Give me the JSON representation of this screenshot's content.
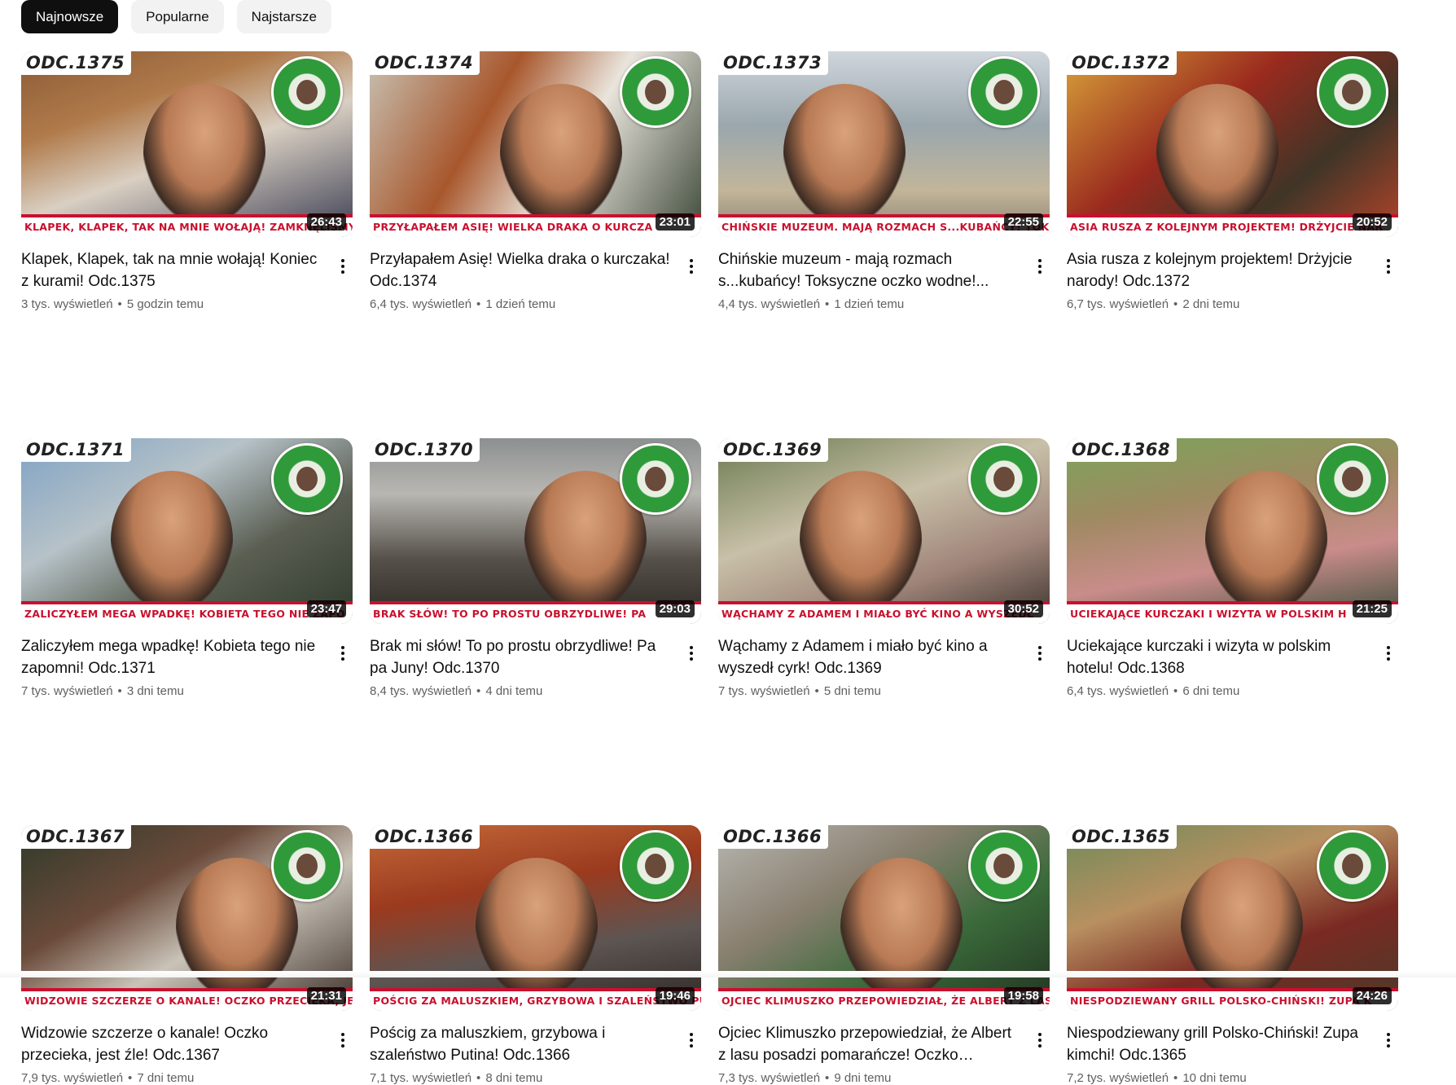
{
  "filters": [
    "Najnowsze",
    "Popularne",
    "Najstarsze"
  ],
  "active_filter": "Najnowsze",
  "videos": [
    {
      "ep": "ODC.1375",
      "banner": "Klapek, klapek, tak na mnie wołają! Zamknęliśmy tema",
      "duration": "26:43",
      "title": "Klapek, Klapek, tak na mnie wołają! Koniec z kurami! Odc.1375",
      "views": "3 tys. wyświetleń",
      "age": "5 godzin temu"
    },
    {
      "ep": "ODC.1374",
      "banner": "Przyłapałem Asię! Wielka draka o kurcza",
      "duration": "23:01",
      "title": "Przyłapałem Asię! Wielka draka o kurczaka! Odc.1374",
      "views": "6,4 tys. wyświetleń",
      "age": "1 dzień temu"
    },
    {
      "ep": "ODC.1373",
      "banner": "Chińskie muzeum. Mają rozmach s...kubańcy! Toksyczne",
      "duration": "22:55",
      "title": "Chińskie muzeum - mają rozmach s...kubańcy! Toksyczne oczko wodne!...",
      "views": "4,4 tys. wyświetleń",
      "age": "1 dzień temu"
    },
    {
      "ep": "ODC.1372",
      "banner": "Asia rusza z kolejnym projektem! Drżyjcie nar",
      "duration": "20:52",
      "title": "Asia rusza z kolejnym projektem! Drżyjcie narody! Odc.1372",
      "views": "6,7 tys. wyświetleń",
      "age": "2 dni temu"
    },
    {
      "ep": "ODC.1371",
      "banner": "Zaliczyłem mega wpadkę! Kobieta tego nie zapo",
      "duration": "23:47",
      "title": "Zaliczyłem mega wpadkę! Kobieta tego nie zapomni! Odc.1371",
      "views": "7 tys. wyświetleń",
      "age": "3 dni temu"
    },
    {
      "ep": "ODC.1370",
      "banner": "Brak słów! To po prostu obrzydliwe! Pa",
      "duration": "29:03",
      "title": "Brak mi słów! To po prostu obrzydliwe! Pa pa Juny! Odc.1370",
      "views": "8,4 tys. wyświetleń",
      "age": "4 dni temu"
    },
    {
      "ep": "ODC.1369",
      "banner": "Wąchamy z Adamem i miało być kino a wyszedł",
      "duration": "30:52",
      "title": "Wąchamy z Adamem i miało być kino a wyszedł cyrk! Odc.1369",
      "views": "7 tys. wyświetleń",
      "age": "5 dni temu"
    },
    {
      "ep": "ODC.1368",
      "banner": "Uciekające kurczaki i wizyta w polskim h",
      "duration": "21:25",
      "title": "Uciekające kurczaki i wizyta w polskim hotelu! Odc.1368",
      "views": "6,4 tys. wyświetleń",
      "age": "6 dni temu"
    },
    {
      "ep": "ODC.1367",
      "banner": "Widzowie szczerze o kanale! Oczko przecieka, je",
      "duration": "21:31",
      "title": "Widzowie szczerze o kanale! Oczko przecieka, jest źle! Odc.1367",
      "views": "7,9 tys. wyświetleń",
      "age": "7 dni temu"
    },
    {
      "ep": "ODC.1366",
      "banner": "Pościg za maluszkiem, grzybowa i szaleństwo pu",
      "duration": "19:46",
      "title": "Pościg za maluszkiem, grzybowa i szaleństwo Putina! Odc.1366",
      "views": "7,1 tys. wyświetleń",
      "age": "8 dni temu"
    },
    {
      "ep": "ODC.1366",
      "banner": "Ojciec Klimuszko przepowiedział, że Albert z lasu po",
      "duration": "19:58",
      "title": "Ojciec Klimuszko przepowiedział, że Albert z lasu posadzi pomarańcze! Oczko wodne....",
      "views": "7,3 tys. wyświetleń",
      "age": "9 dni temu"
    },
    {
      "ep": "ODC.1365",
      "banner": "Niespodziewany grill Polsko-Chiński! Zupa k",
      "duration": "24:26",
      "title": "Niespodziewany grill Polsko-Chiński! Zupa kimchi! Odc.1365",
      "views": "7,2 tys. wyświetleń",
      "age": "10 dni temu"
    }
  ],
  "colors": {
    "active_chip_bg": "#0f0f0f",
    "chip_bg": "#f2f2f2",
    "banner_red": "#c8102e",
    "meta_gray": "#606060"
  }
}
